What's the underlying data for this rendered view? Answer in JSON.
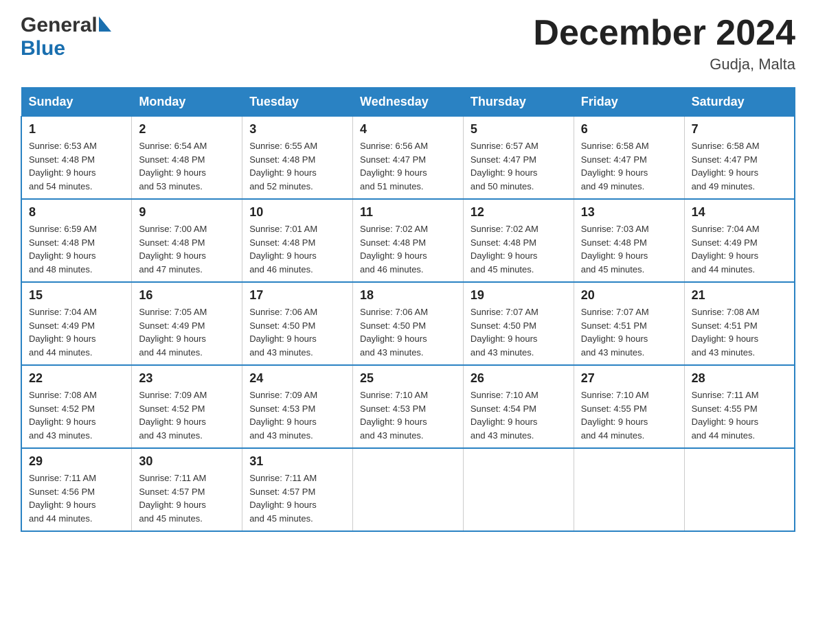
{
  "header": {
    "logo_general": "General",
    "logo_blue": "Blue",
    "month_title": "December 2024",
    "location": "Gudja, Malta"
  },
  "days_of_week": [
    "Sunday",
    "Monday",
    "Tuesday",
    "Wednesday",
    "Thursday",
    "Friday",
    "Saturday"
  ],
  "weeks": [
    [
      {
        "day": "1",
        "sunrise": "6:53 AM",
        "sunset": "4:48 PM",
        "daylight": "9 hours and 54 minutes."
      },
      {
        "day": "2",
        "sunrise": "6:54 AM",
        "sunset": "4:48 PM",
        "daylight": "9 hours and 53 minutes."
      },
      {
        "day": "3",
        "sunrise": "6:55 AM",
        "sunset": "4:48 PM",
        "daylight": "9 hours and 52 minutes."
      },
      {
        "day": "4",
        "sunrise": "6:56 AM",
        "sunset": "4:47 PM",
        "daylight": "9 hours and 51 minutes."
      },
      {
        "day": "5",
        "sunrise": "6:57 AM",
        "sunset": "4:47 PM",
        "daylight": "9 hours and 50 minutes."
      },
      {
        "day": "6",
        "sunrise": "6:58 AM",
        "sunset": "4:47 PM",
        "daylight": "9 hours and 49 minutes."
      },
      {
        "day": "7",
        "sunrise": "6:58 AM",
        "sunset": "4:47 PM",
        "daylight": "9 hours and 49 minutes."
      }
    ],
    [
      {
        "day": "8",
        "sunrise": "6:59 AM",
        "sunset": "4:48 PM",
        "daylight": "9 hours and 48 minutes."
      },
      {
        "day": "9",
        "sunrise": "7:00 AM",
        "sunset": "4:48 PM",
        "daylight": "9 hours and 47 minutes."
      },
      {
        "day": "10",
        "sunrise": "7:01 AM",
        "sunset": "4:48 PM",
        "daylight": "9 hours and 46 minutes."
      },
      {
        "day": "11",
        "sunrise": "7:02 AM",
        "sunset": "4:48 PM",
        "daylight": "9 hours and 46 minutes."
      },
      {
        "day": "12",
        "sunrise": "7:02 AM",
        "sunset": "4:48 PM",
        "daylight": "9 hours and 45 minutes."
      },
      {
        "day": "13",
        "sunrise": "7:03 AM",
        "sunset": "4:48 PM",
        "daylight": "9 hours and 45 minutes."
      },
      {
        "day": "14",
        "sunrise": "7:04 AM",
        "sunset": "4:49 PM",
        "daylight": "9 hours and 44 minutes."
      }
    ],
    [
      {
        "day": "15",
        "sunrise": "7:04 AM",
        "sunset": "4:49 PM",
        "daylight": "9 hours and 44 minutes."
      },
      {
        "day": "16",
        "sunrise": "7:05 AM",
        "sunset": "4:49 PM",
        "daylight": "9 hours and 44 minutes."
      },
      {
        "day": "17",
        "sunrise": "7:06 AM",
        "sunset": "4:50 PM",
        "daylight": "9 hours and 43 minutes."
      },
      {
        "day": "18",
        "sunrise": "7:06 AM",
        "sunset": "4:50 PM",
        "daylight": "9 hours and 43 minutes."
      },
      {
        "day": "19",
        "sunrise": "7:07 AM",
        "sunset": "4:50 PM",
        "daylight": "9 hours and 43 minutes."
      },
      {
        "day": "20",
        "sunrise": "7:07 AM",
        "sunset": "4:51 PM",
        "daylight": "9 hours and 43 minutes."
      },
      {
        "day": "21",
        "sunrise": "7:08 AM",
        "sunset": "4:51 PM",
        "daylight": "9 hours and 43 minutes."
      }
    ],
    [
      {
        "day": "22",
        "sunrise": "7:08 AM",
        "sunset": "4:52 PM",
        "daylight": "9 hours and 43 minutes."
      },
      {
        "day": "23",
        "sunrise": "7:09 AM",
        "sunset": "4:52 PM",
        "daylight": "9 hours and 43 minutes."
      },
      {
        "day": "24",
        "sunrise": "7:09 AM",
        "sunset": "4:53 PM",
        "daylight": "9 hours and 43 minutes."
      },
      {
        "day": "25",
        "sunrise": "7:10 AM",
        "sunset": "4:53 PM",
        "daylight": "9 hours and 43 minutes."
      },
      {
        "day": "26",
        "sunrise": "7:10 AM",
        "sunset": "4:54 PM",
        "daylight": "9 hours and 43 minutes."
      },
      {
        "day": "27",
        "sunrise": "7:10 AM",
        "sunset": "4:55 PM",
        "daylight": "9 hours and 44 minutes."
      },
      {
        "day": "28",
        "sunrise": "7:11 AM",
        "sunset": "4:55 PM",
        "daylight": "9 hours and 44 minutes."
      }
    ],
    [
      {
        "day": "29",
        "sunrise": "7:11 AM",
        "sunset": "4:56 PM",
        "daylight": "9 hours and 44 minutes."
      },
      {
        "day": "30",
        "sunrise": "7:11 AM",
        "sunset": "4:57 PM",
        "daylight": "9 hours and 45 minutes."
      },
      {
        "day": "31",
        "sunrise": "7:11 AM",
        "sunset": "4:57 PM",
        "daylight": "9 hours and 45 minutes."
      },
      null,
      null,
      null,
      null
    ]
  ],
  "labels": {
    "sunrise": "Sunrise: ",
    "sunset": "Sunset: ",
    "daylight": "Daylight: "
  }
}
